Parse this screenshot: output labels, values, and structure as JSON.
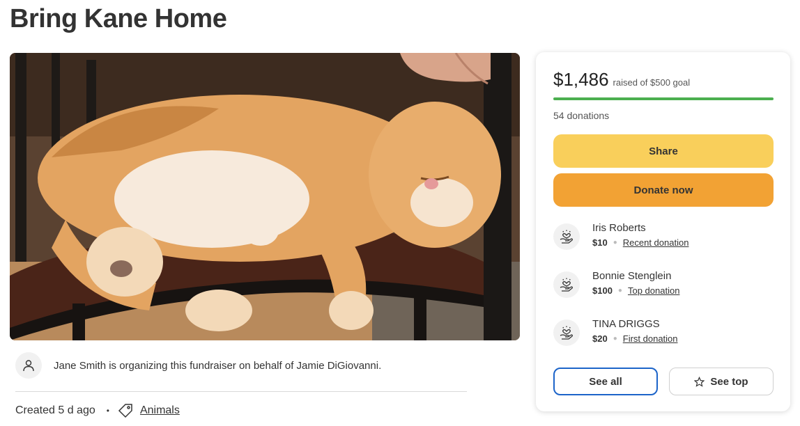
{
  "page": {
    "title": "Bring Kane Home"
  },
  "organizer": {
    "text": "Jane Smith is organizing this fundraiser on behalf of Jamie DiGiovanni."
  },
  "meta": {
    "created": "Created 5 d ago",
    "separator": "•",
    "category": "Animals"
  },
  "summary": {
    "amount": "$1,486",
    "goal_text": "raised of $500 goal",
    "progress_fraction": 1.0,
    "donations_count": "54 donations"
  },
  "actions": {
    "share": "Share",
    "donate": "Donate now",
    "see_all": "See all",
    "see_top": "See top"
  },
  "donations": [
    {
      "name": "Iris Roberts",
      "amount": "$10",
      "label": "Recent donation"
    },
    {
      "name": "Bonnie Stenglein",
      "amount": "$100",
      "label": "Top donation"
    },
    {
      "name": "TINA DRIGGS",
      "amount": "$20",
      "label": "First donation"
    }
  ],
  "colors": {
    "progress": "#4caf50",
    "share_button": "#f9cf5b",
    "donate_button": "#f2a234",
    "see_all_border": "#1c64c9"
  },
  "icons": {
    "organizer": "person-icon",
    "category": "tag-icon",
    "donor": "heart-hand-icon",
    "see_top": "star-icon"
  }
}
